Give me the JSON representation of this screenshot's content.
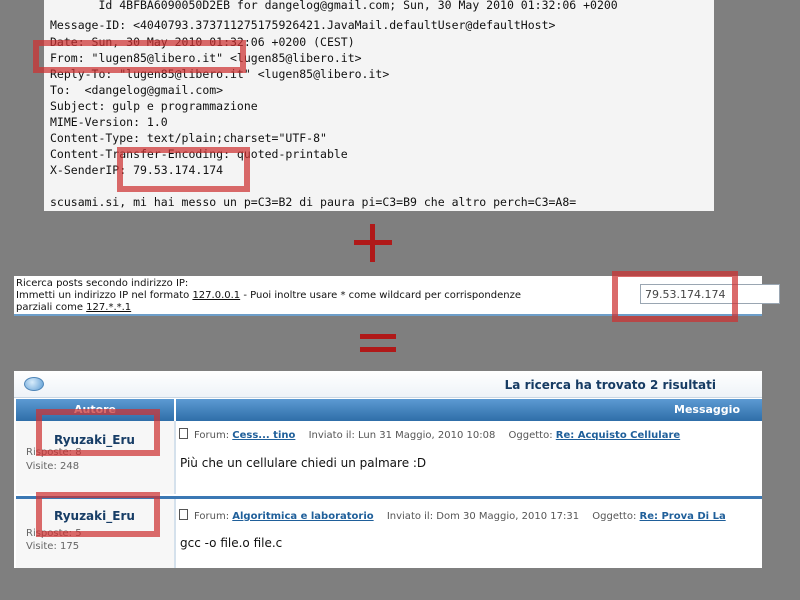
{
  "email": {
    "lines": [
      "       Id 4BFBA6090050D2EB for dangelog@gmail.com; Sun, 30 May 2010 01:32:06 +0200",
      "Message-ID: <4040793.373711275175926421.JavaMail.defaultUser@defaultHost>",
      "Date: Sun, 30 May 2010 01:32:06 +0200 (CEST)",
      "From: \"lugen85@libero.it\" <lugen85@libero.it>",
      "Reply-To: \"lugen85@libero.it\" <lugen85@libero.it>",
      "To:  <dangelog@gmail.com>",
      "Subject: gulp e programmazione",
      "MIME-Version: 1.0",
      "Content-Type: text/plain;charset=\"UTF-8\"",
      "Content-Transfer-Encoding: quoted-printable",
      "X-SenderIP: 79.53.174.174",
      "",
      "scusami.si, mi hai messo un p=C3=B2 di paura pi=C3=B9 che altro perch=C3=A8="
    ]
  },
  "ip_search": {
    "line1": "Ricerca posts secondo indirizzo IP:",
    "line2_prefix": "Immetti un indirizzo IP nel formato ",
    "example1": "127.0.0.1",
    "line2_suffix": " - Puoi inoltre usare * come wildcard per corrispondenze",
    "line3_prefix": "parziali come ",
    "example2": "127.*.*.1",
    "input_value": "79.53.174.174"
  },
  "results": {
    "title": "La ricerca ha trovato 2 risultati",
    "col_author": "Autore",
    "col_message": "Messaggio",
    "rows": [
      {
        "author": "Ryuzaki_Eru",
        "replies": "Risposte: 8",
        "visits": "Visite: 248",
        "forum_label": "Forum:",
        "forum": "Cess... tino",
        "sent_label": "Inviato il:",
        "sent": "Lun 31 Maggio, 2010 10:08",
        "subject_label": "Oggetto:",
        "subject": "Re: Acquisto Cellulare",
        "text": "Più che un cellulare chiedi un palmare :D"
      },
      {
        "author": "Ryuzaki_Eru",
        "replies": "Risposte: 5",
        "visits": "Visite: 175",
        "forum_label": "Forum:",
        "forum": "Algoritmica e laboratorio",
        "sent_label": "Inviato il:",
        "sent": "Dom 30 Maggio, 2010 17:31",
        "subject_label": "Oggetto:",
        "subject": "Re: Prova Di La",
        "text": "gcc -o file.o file.c"
      }
    ]
  },
  "colors": {
    "highlight": "#cd3232",
    "plus_equals": "#b01919",
    "header_blue": "#2f6ea8"
  }
}
